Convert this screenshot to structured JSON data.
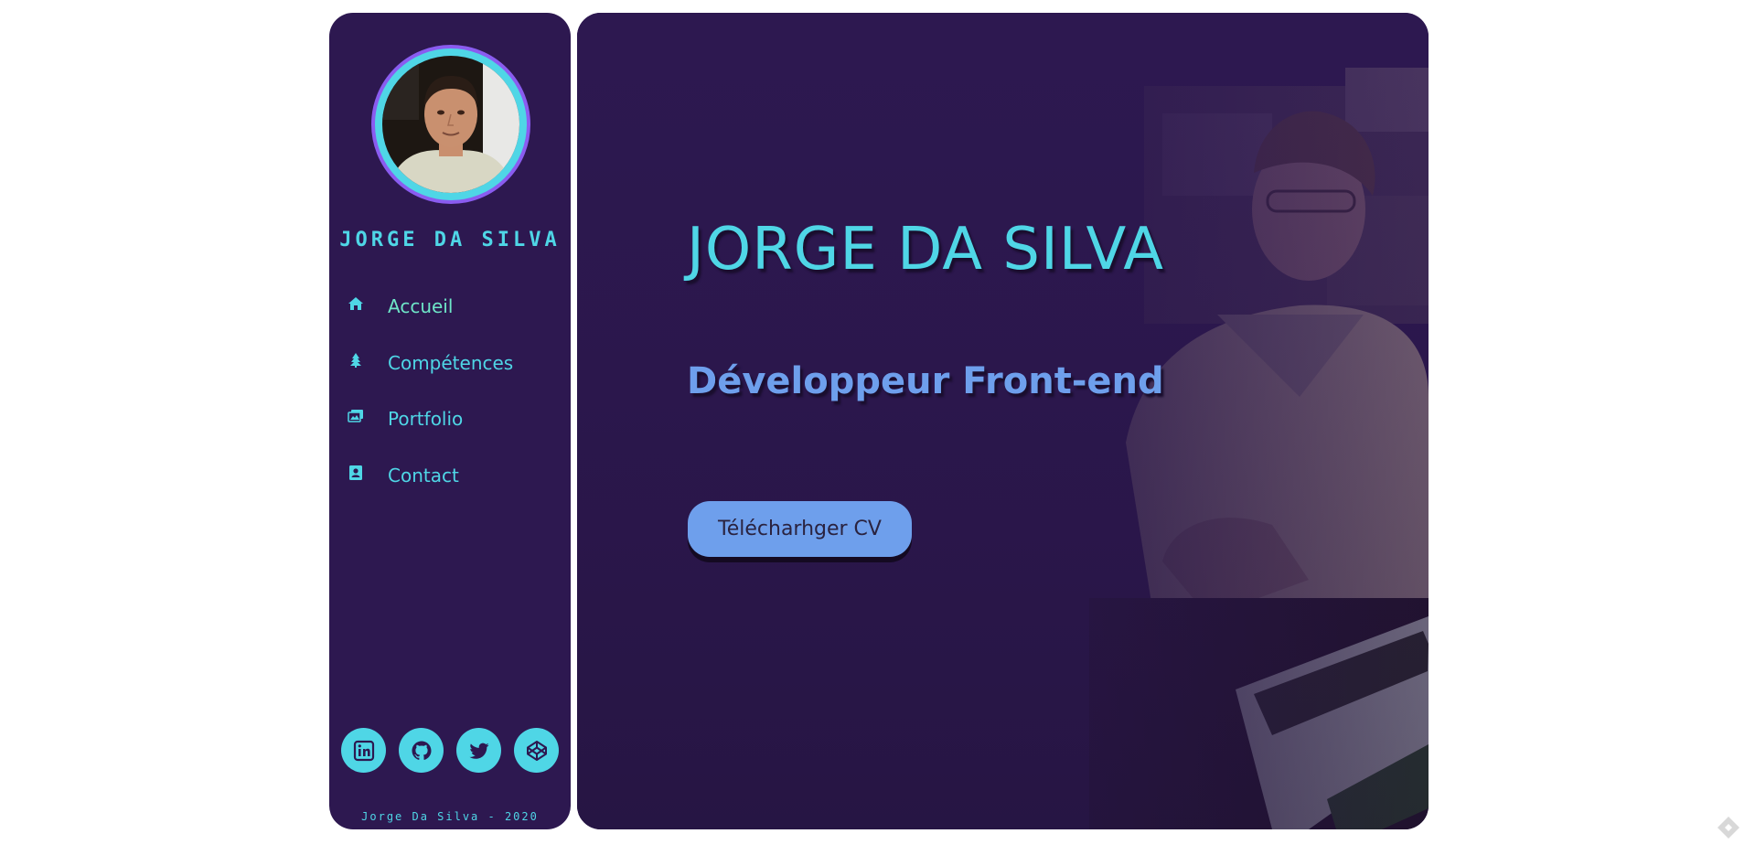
{
  "sidebar": {
    "name": "JORGE DA SILVA",
    "avatar_alt": "profile-photo",
    "nav": [
      {
        "label": "Accueil",
        "icon": "home-icon",
        "active": true
      },
      {
        "label": "Compétences",
        "icon": "tree-icon",
        "active": false
      },
      {
        "label": "Portfolio",
        "icon": "images-icon",
        "active": false
      },
      {
        "label": "Contact",
        "icon": "contact-card-icon",
        "active": false
      }
    ],
    "socials": [
      {
        "icon": "linkedin-icon"
      },
      {
        "icon": "github-icon"
      },
      {
        "icon": "twitter-icon"
      },
      {
        "icon": "codepen-icon"
      }
    ],
    "footer": "Jorge Da Silva - 2020"
  },
  "hero": {
    "title": "JORGE DA SILVA",
    "subtitle": "Développeur Front-end",
    "cta_label": "Télécharhger CV"
  },
  "colors": {
    "background": "#ffffff",
    "panel": "#2d1850",
    "accent_cyan": "#4fd6e6",
    "accent_blue": "#6e9fec",
    "ring_purple": "#8a5cf0"
  }
}
